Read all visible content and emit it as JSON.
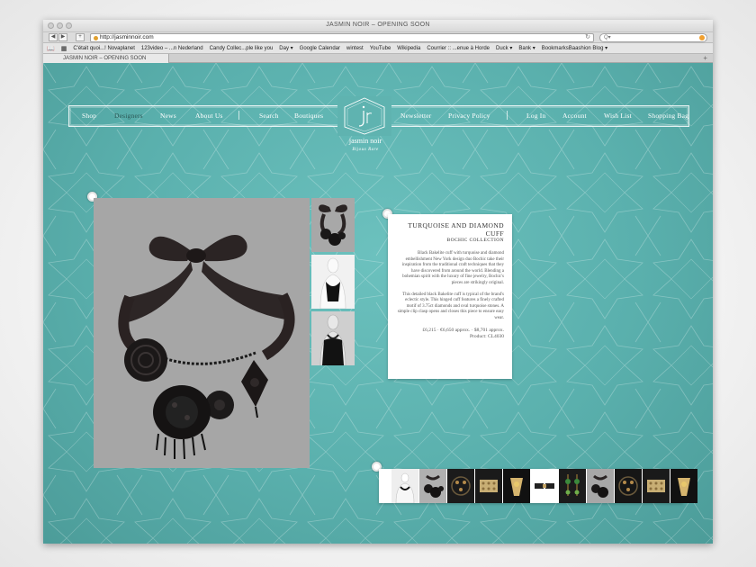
{
  "browser": {
    "window_title": "JASMIN NOIR – OPENING SOON",
    "url": "http://jasminnoir.com",
    "search_placeholder": "Q▾",
    "tab_title": "JASMIN NOIR – OPENING SOON",
    "bookmarks": [
      "C'était quoi...! Novaplanet",
      "123video – ...n Nederland",
      "Candy Collec...ple like you",
      "Day ▾",
      "Google Calendar",
      "wintest",
      "YouTube",
      "Wikipedia",
      "Courrier :: ...enue à Horde",
      "Duck ▾",
      "Bank ▾",
      "BookmarksBaashion Blog ▾"
    ]
  },
  "nav": {
    "left": [
      "Shop",
      "Designers",
      "News",
      "About Us"
    ],
    "middle_left": [
      "Search",
      "Boutiques"
    ],
    "middle_right": [
      "Newsletter",
      "Privacy Policy"
    ],
    "right": [
      "Log In",
      "Account",
      "Wish List",
      "Shopping Bag"
    ],
    "active": "Designers"
  },
  "logo": {
    "brand": "jasmin noir",
    "tagline": "Bijoux Rare"
  },
  "product": {
    "title": "TURQUOISE AND DIAMOND CUFF",
    "collection": "BOCHIC COLLECTION",
    "paragraph1": "Black Bakelite cuff with turquoise and diamond embellishment New York design duo Bochic take their inspiration from the traditional craft techniques that they have discovered from around the world. Blending a bohemian spirit with the luxury of fine jewelry, Bochic's pieces are strikingly original.",
    "paragraph2": "This detailed black Bakelite cuff is typical of the brand's eclectic style. This hinged cuff features a finely crafted motif of 3.75ct diamonds and oval turquoise stones. A simple clip clasp opens and closes this piece to ensure easy wear.",
    "price_line": "£6,215 · €6,650 approx. · $8,701 approx.",
    "product_code": "Product: CL4030"
  },
  "colors": {
    "page_bg": "#5fb3b0",
    "active_nav": "#2c5856"
  }
}
